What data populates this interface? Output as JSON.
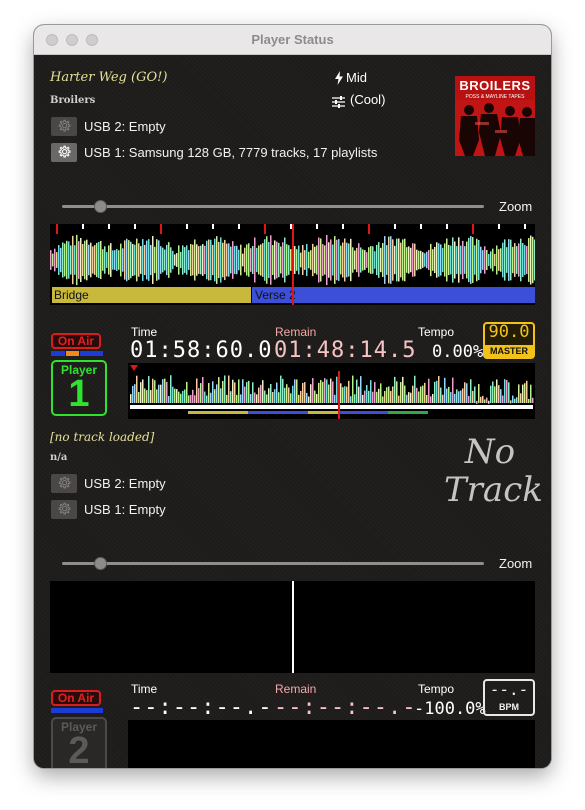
{
  "window": {
    "title": "Player Status"
  },
  "player1": {
    "track_title": "Harter Weg (GO!)",
    "artist": "Broilers",
    "key": "Mid",
    "mood": "(Cool)",
    "art_text_1": "BROILERS",
    "art_text_2": "POSS & MAYLINE TAPES",
    "usb2": "USB 2: Empty",
    "usb1": "USB 1: Samsung 128 GB, 7779 tracks, 17 playlists",
    "zoom_label": "Zoom",
    "phrase_1": "Bridge",
    "phrase_2": "Verse 2",
    "on_air": "On Air",
    "badge_label": "Player",
    "badge_number": "1",
    "time_label": "Time",
    "time_value": "01:58:60.0",
    "remain_label": "Remain",
    "remain_value": "01:48:14.5",
    "tempo_label": "Tempo",
    "tempo_value": "0.00%",
    "bpm_value": "90.0",
    "master_label": "MASTER",
    "zoom_level": 0.09,
    "colors": {
      "on_air": "#e32020",
      "player_badge": "#2ee22e",
      "bridge": "#c8b83c",
      "verse": "#3c4fd8",
      "master": "#f2c21a"
    }
  },
  "player2": {
    "track_title": "[no track loaded]",
    "artist": "n/a",
    "no_track_line1": "No",
    "no_track_line2": "Track",
    "usb2": "USB 2: Empty",
    "usb1": "USB 1: Empty",
    "zoom_label": "Zoom",
    "on_air": "On Air",
    "badge_label": "Player",
    "badge_number": "2",
    "time_label": "Time",
    "time_value": "--:--:--.-",
    "remain_label": "Remain",
    "remain_value": "--:--:--.-",
    "tempo_label": "Tempo",
    "tempo_value": "-100.0%",
    "bpm_value": "--.-",
    "bpm_label": "BPM",
    "zoom_level": 0.09
  },
  "icons": {
    "key": "bolt-icon",
    "mood": "sliders-icon",
    "media": "gear-icon"
  }
}
